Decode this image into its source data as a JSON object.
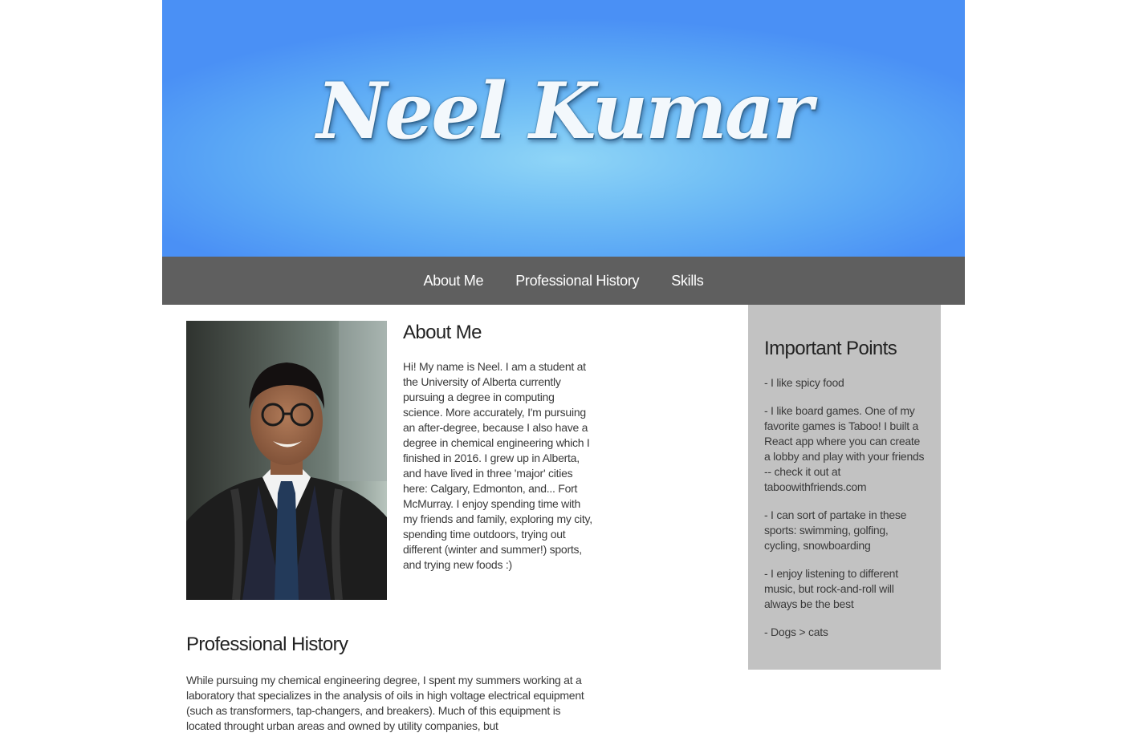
{
  "banner": {
    "title": "Neel Kumar"
  },
  "nav": {
    "items": [
      {
        "label": "About Me"
      },
      {
        "label": "Professional History"
      },
      {
        "label": "Skills"
      }
    ]
  },
  "about": {
    "heading": "About Me",
    "text": "Hi! My name is Neel. I am a student at the University of Alberta currently pursuing a degree in computing science. More accurately, I'm pursuing an after-degree, because I also have a degree in chemical engineering which I finished in 2016. I grew up in Alberta, and have lived in three 'major' cities here: Calgary, Edmonton, and... Fort McMurray. I enjoy spending time with my friends and family, exploring my city, spending time outdoors, trying out different (winter and summer!) sports, and trying new foods :)"
  },
  "history": {
    "heading": "Professional History",
    "text": "While pursuing my chemical engineering degree, I spent my summers working at a laboratory that specializes in the analysis of oils in high voltage electrical equipment (such as transformers, tap-changers, and breakers). Much of this equipment is located throught urban areas and owned by utility companies, but"
  },
  "sidebar": {
    "heading": "Important Points",
    "points": [
      "- I like spicy food",
      "- I like board games. One of my favorite games is Taboo! I built a React app where you can create a lobby and play with your friends -- check it out at taboowithfriends.com",
      "- I can sort of partake in these sports: swimming, golfing, cycling, snowboarding",
      "- I enjoy listening to different music, but rock-and-roll will always be the best",
      "- Dogs > cats"
    ]
  },
  "colors": {
    "banner_blue": "#5aa7f5",
    "nav_bg": "#5f5f5f",
    "sidebar_bg": "#c2c2c2"
  }
}
